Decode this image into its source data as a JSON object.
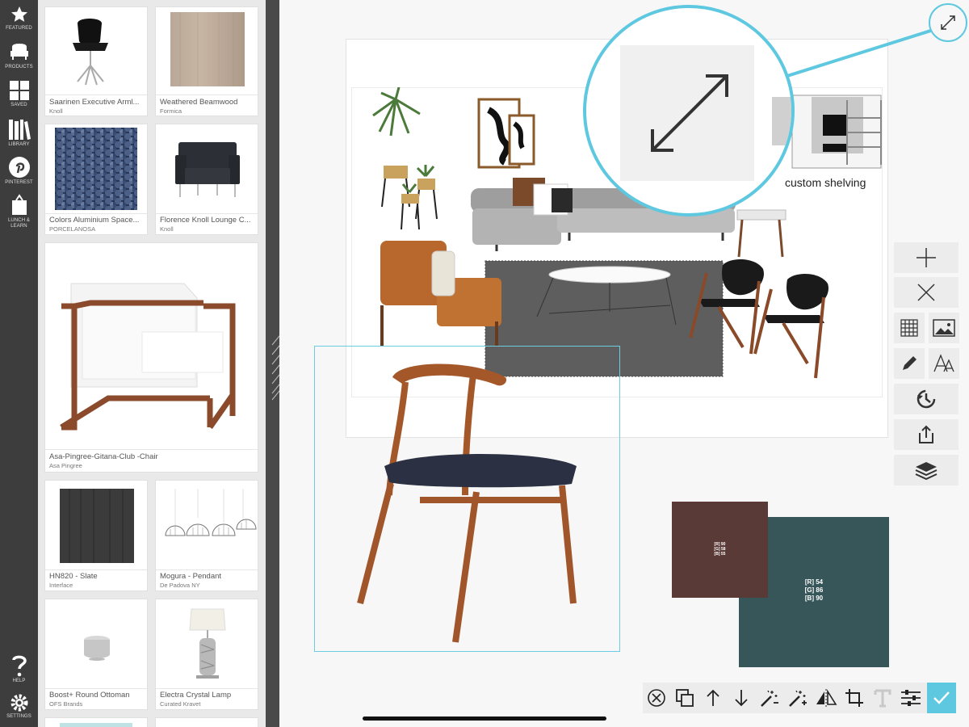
{
  "rail": {
    "items": [
      {
        "label": "FEATURED",
        "icon": "star-icon"
      },
      {
        "label": "PRODUCTS",
        "icon": "chair-icon"
      },
      {
        "label": "SAVED",
        "icon": "grid-icon"
      },
      {
        "label": "LIBRARY",
        "icon": "books-icon"
      },
      {
        "label": "PINTEREST",
        "icon": "pinterest-icon"
      },
      {
        "label": "LUNCH &",
        "label2": "LEARN",
        "icon": "easel-icon"
      }
    ],
    "help": {
      "label": "HELP",
      "icon": "question-icon"
    },
    "settings": {
      "label": "SETTINGS",
      "icon": "gear-icon"
    }
  },
  "products": [
    {
      "name": "Saarinen Executive Arml...",
      "brand": "Knoll"
    },
    {
      "name": "Weathered Beamwood",
      "brand": "Formica"
    },
    {
      "name": "Colors Aluminium Space...",
      "brand": "PORCELANOSA"
    },
    {
      "name": "Florence Knoll Lounge C...",
      "brand": "Knoll"
    },
    {
      "name": "Asa-Pingree-Gitana-Club -Chair",
      "brand": "Asa Pingree"
    },
    {
      "name": "HN820 - Slate",
      "brand": "Interface"
    },
    {
      "name": "Mogura - Pendant",
      "brand": "De Padova NY"
    },
    {
      "name": "Boost+ Round Ottoman",
      "brand": "OFS Brands"
    },
    {
      "name": "Electra Crystal Lamp",
      "brand": "Curated Kravet"
    }
  ],
  "board": {
    "caption": "custom shelving"
  },
  "swatches": [
    {
      "r": "[R] 90",
      "g": "[G] 58",
      "b": "[B] 55",
      "color": "#5a3a37"
    },
    {
      "r": "[R] 54",
      "g": "[G] 86",
      "b": "[B] 90",
      "color": "#36565a"
    }
  ],
  "tools": [
    "add-icon",
    "delete-icon",
    "grid-icon",
    "image-icon",
    "pencil-icon",
    "text-size-icon",
    "history-icon",
    "share-icon",
    "layers-icon"
  ],
  "bottom_tools": [
    "deselect-icon",
    "duplicate-icon",
    "bring-forward-icon",
    "send-backward-icon",
    "magic-wand-minus-icon",
    "magic-wand-plus-icon",
    "flip-icon",
    "crop-icon",
    "text-icon",
    "adjust-icon",
    "confirm-icon"
  ],
  "colors": {
    "accent": "#5ec8e0",
    "confirm": "#5ec8e0"
  }
}
